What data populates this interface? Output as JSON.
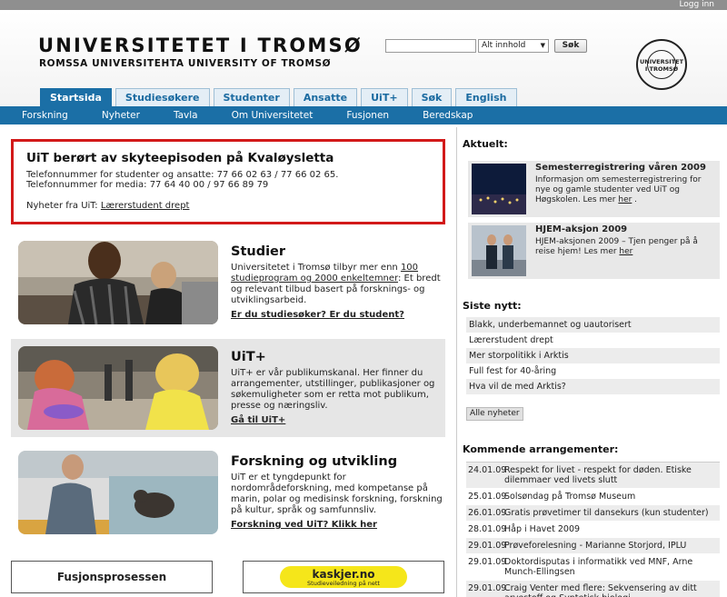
{
  "topbar": {
    "login": "Logg inn"
  },
  "header": {
    "title": "UNIVERSITETET I TROMSØ",
    "subtitle": "ROMSSA UNIVERSITEHTA   UNIVERSITY OF TROMSØ",
    "search_select": "Alt innhold",
    "search_button": "Søk",
    "seal_text": "UNIVERSITET I TROMSØ"
  },
  "tabs": [
    "Startsida",
    "Studiesøkere",
    "Studenter",
    "Ansatte",
    "UiT+",
    "Søk",
    "English"
  ],
  "nav": [
    "Forskning",
    "Nyheter",
    "Tavla",
    "Om Universitetet",
    "Fusjonen",
    "Beredskap"
  ],
  "alert": {
    "title": "UiT berørt av skyteepisoden på Kvaløysletta",
    "line1": "Telefonnummer for studenter og ansatte: 77 66 02 63 / 77 66 02 65.",
    "line2": "Telefonnummer for media: 77 64 40 00 / 97 66 89 79",
    "news_prefix": "Nyheter fra UiT:",
    "news_link": "Lærerstudent drept"
  },
  "features": [
    {
      "title": "Studier",
      "text_pre": "Universitetet i Tromsø tilbyr mer enn ",
      "text_link": "100 studieprogram og 2000 enkeltemner",
      "text_post": ": Et bredt og relevant tilbud basert på forsknings- og utviklingsarbeid.",
      "link1": "Er du studiesøker?",
      "link2": "Er du student?"
    },
    {
      "title": "UiT+",
      "text": "UiT+ er vår publikumskanal. Her finner du arrangementer, utstillinger, publikasjoner og søkemuligheter som er retta mot publikum, presse og næringsliv.",
      "link": "Gå til UiT+"
    },
    {
      "title": "Forskning og utvikling",
      "text": "UiT er et tyngdepunkt for nordområdeforskning, med kompetanse på marin, polar og medisinsk forskning, forskning på kultur, språk og samfunnsliv.",
      "link": "Forskning ved UiT? Klikk her"
    }
  ],
  "bottom": {
    "fusjon": "Fusjonsprosessen",
    "kaskjer": "kaskjer.no",
    "kaskjer_sub": "Studieveiledning på nett"
  },
  "aktuelt": {
    "heading": "Aktuelt:",
    "items": [
      {
        "title": "Semesterregistrering våren 2009",
        "desc": "Informasjon om semesterregistrering for nye og gamle studenter ved UiT og Høgskolen. Les mer ",
        "link": "her",
        "end": " ."
      },
      {
        "title": "HJEM-aksjon 2009",
        "desc": "HJEM-aksjonen 2009 – Tjen penger på å reise hjem! Les mer ",
        "link": "her",
        "end": ""
      }
    ]
  },
  "siste": {
    "heading": "Siste nytt:",
    "items": [
      "Blakk, underbemannet og uautorisert",
      "Lærerstudent drept",
      "Mer storpolitikk i Arktis",
      "Full fest for 40-åring",
      "Hva vil de med Arktis?"
    ],
    "button": "Alle nyheter"
  },
  "kommende": {
    "heading": "Kommende arrangementer:",
    "events": [
      {
        "date": "24.01.09",
        "title": "Respekt for livet - respekt for døden. Etiske dilemmaer ved livets slutt"
      },
      {
        "date": "25.01.09",
        "title": "Solsøndag på Tromsø Museum"
      },
      {
        "date": "26.01.09",
        "title": "Gratis prøvetimer til dansekurs (kun studenter)"
      },
      {
        "date": "28.01.09",
        "title": "Håp i Havet 2009"
      },
      {
        "date": "29.01.09",
        "title": "Prøveforelesning - Marianne Storjord, IPLU"
      },
      {
        "date": "29.01.09",
        "title": "Doktordisputas i informatikk ved MNF, Arne Munch-Ellingsen"
      },
      {
        "date": "29.01.09",
        "title": "Craig Venter med flere: Sekvensering av ditt arvestoff og Syntetisk biologi"
      }
    ]
  },
  "colors": {
    "nav_blue": "#1b6fa6",
    "alert_red": "#d21919",
    "kaskjer_yellow": "#f5e61a"
  }
}
